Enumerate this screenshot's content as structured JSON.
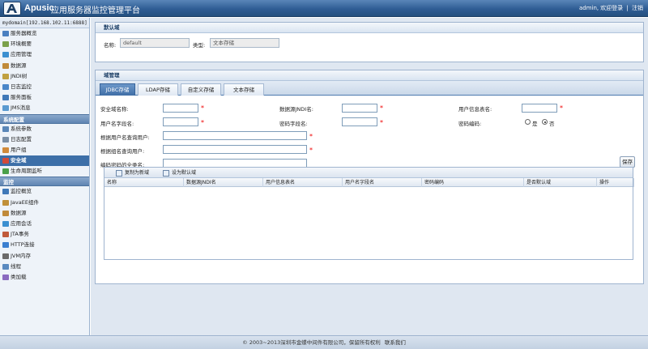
{
  "header": {
    "brand": "Apusic",
    "title": "应用服务器监控管理平台",
    "user": "admin,",
    "logout_label": "欢迎登录",
    "separator": "|",
    "cancel_label": "注销",
    "accent_color": "#2f5d94"
  },
  "sidebar": {
    "server": "mydomain[192.168.102.11:6888]",
    "items_top": [
      {
        "label": "服务器概览",
        "icon": "server-overview-icon",
        "color": "#4a7fc0"
      },
      {
        "label": "环境概要",
        "icon": "environment-icon",
        "color": "#7aa04a"
      },
      {
        "label": "应用管理",
        "icon": "app-manage-icon",
        "color": "#3b8fd0"
      },
      {
        "label": "数据源",
        "icon": "datasource-icon",
        "color": "#c08a3a"
      },
      {
        "label": "JNDI树",
        "icon": "jndi-tree-icon",
        "color": "#c0a040"
      },
      {
        "label": "日志监控",
        "icon": "log-monitor-icon",
        "color": "#4a86c8"
      },
      {
        "label": "服务面板",
        "icon": "service-panel-icon",
        "color": "#3f78b8"
      },
      {
        "label": "JMS消息",
        "icon": "jms-icon",
        "color": "#5a9ad0"
      }
    ],
    "group_config": "系统配置",
    "items_config": [
      {
        "label": "系统参数",
        "icon": "system-params-icon",
        "color": "#5a86b8"
      },
      {
        "label": "日志配置",
        "icon": "log-config-icon",
        "color": "#7a8fa6"
      },
      {
        "label": "用户组",
        "icon": "user-group-icon",
        "color": "#d08a3a"
      },
      {
        "label": "安全域",
        "icon": "security-domain-icon",
        "color": "#d04a3a",
        "active": true
      },
      {
        "label": "生命周期监听",
        "icon": "lifecycle-icon",
        "color": "#4aa04a"
      }
    ],
    "group_monitor": "监控",
    "items_monitor": [
      {
        "label": "监控概览",
        "icon": "monitor-overview-icon",
        "color": "#3f78b8"
      },
      {
        "label": "JavaEE组件",
        "icon": "javaee-icon",
        "color": "#c0903a"
      },
      {
        "label": "数据源",
        "icon": "datasource-icon",
        "color": "#c08a3a"
      },
      {
        "label": "应用会话",
        "icon": "session-icon",
        "color": "#3b8fd0"
      },
      {
        "label": "JTA事务",
        "icon": "jta-icon",
        "color": "#c05a3a"
      },
      {
        "label": "HTTP连接",
        "icon": "http-icon",
        "color": "#3b7fd0"
      },
      {
        "label": "JVM内存",
        "icon": "jvm-memory-icon",
        "color": "#6a6a6a"
      },
      {
        "label": "线程",
        "icon": "thread-icon",
        "color": "#5a8ac0"
      },
      {
        "label": "类加载",
        "icon": "classloader-icon",
        "color": "#8a6ac0"
      }
    ]
  },
  "default_domain": {
    "title": "默认域",
    "name_label": "名称:",
    "name_value": "default",
    "type_label": "类型:",
    "type_value": "文本存储"
  },
  "domain_manage": {
    "title": "域管理",
    "tabs": [
      "JDBC存储",
      "LDAP存储",
      "自定义存储",
      "文本存储"
    ],
    "active_tab": 0,
    "fields": {
      "security_domain_name": "安全域名称:",
      "datasource_jndi": "数据源JNDI名:",
      "user_info_table": "用户信息表名:",
      "username_field": "用户名字段名:",
      "password_field": "密码字段名:",
      "password_encoding": "密码编码:",
      "radio_yes": "是",
      "radio_no": "否",
      "query_by_username": "根据用户名查询用户:",
      "query_by_groupname": "根据组名查询用户:",
      "password_fullclass": "编码密码的全类名:"
    },
    "save_label": "保存",
    "toolbar": {
      "copy_new": "复制为新域",
      "set_default": "设为默认域"
    },
    "columns": [
      "名称",
      "数据源JNDI名",
      "用户信息表名",
      "用户名字段名",
      "密码编码",
      "是否默认域",
      "操作"
    ]
  },
  "footer": {
    "text": "© 2003~2013深圳市金蝶中间件有限公司，保留所有权利",
    "contact": "联系我们"
  }
}
